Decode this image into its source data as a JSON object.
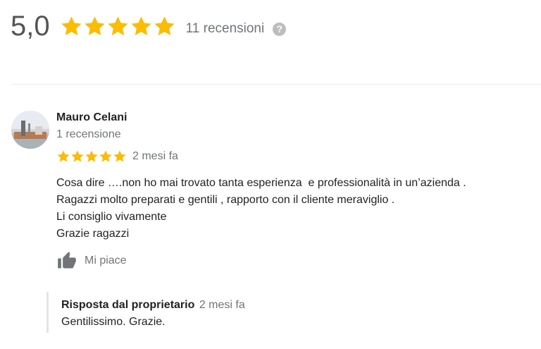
{
  "summary": {
    "score": "5,0",
    "stars": 5,
    "review_count": "11 recensioni",
    "help_icon": "question-icon"
  },
  "colors": {
    "star": "#fbbc04",
    "muted": "#70757a",
    "text": "#222222"
  },
  "review": {
    "author": "Mauro Celani",
    "author_meta": "1 recensione",
    "rating": 5,
    "date": "2 mesi fa",
    "text": "Cosa dire ….non ho mai trovato tanta esperienza  e professionalità in un’azienda .\nRagazzi molto preparati e gentili , rapporto con il cliente meraviglio .\nLi consiglio vivamente\nGrazie ragazzi",
    "like_label": "Mi piace",
    "like_icon": "thumbs-up-icon"
  },
  "owner_reply": {
    "label": "Risposta dal proprietario",
    "date": "2 mesi fa",
    "text": "Gentilissimo. Grazie."
  }
}
